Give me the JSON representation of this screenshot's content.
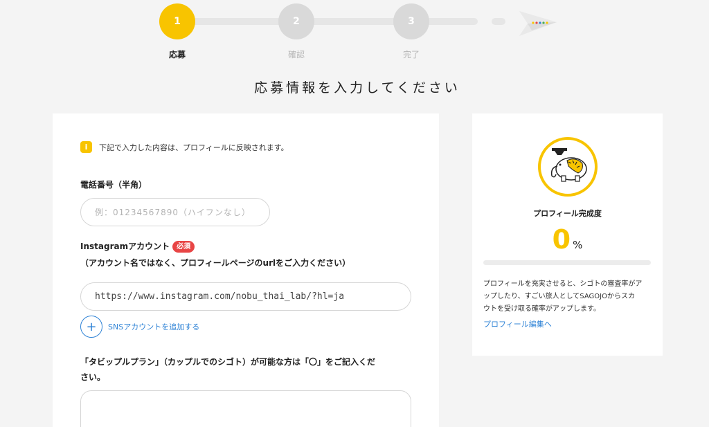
{
  "stepper": {
    "steps": [
      {
        "number": "1",
        "label": "応募",
        "state": "active"
      },
      {
        "number": "2",
        "label": "確認",
        "state": "inactive"
      },
      {
        "number": "3",
        "label": "完了",
        "state": "inactive"
      }
    ],
    "finish_icon": "paper-plane-icon"
  },
  "page_title": "応募情報を入力してください",
  "notice": {
    "icon": "info-icon",
    "text": "下記で入力した内容は、プロフィールに反映されます。"
  },
  "phone": {
    "label": "電話番号（半角）",
    "placeholder": "例：01234567890（ハイフンなし）",
    "value": ""
  },
  "instagram": {
    "label": "Instagramアカウント",
    "required_badge": "必須",
    "sub_label": "（アカウント名ではなく、プロフィールページのurlをご入力ください）",
    "value": "https://www.instagram.com/nobu_thai_lab/?hl=ja"
  },
  "add_sns": {
    "icon": "plus-icon",
    "label": "SNSアカウントを追加する"
  },
  "couple_plan": {
    "label_line1": "「タビップルプラン」（カップルでのシゴト）が可能な方は「〇」をご記入くだ",
    "label_line2": "さい。",
    "value": ""
  },
  "profile_panel": {
    "avatar_icon": "elephant-mascot-icon",
    "title": "プロフィール完成度",
    "percent": "0",
    "percent_sign": "%",
    "progress": 0,
    "desc_line1": "プロフィールを充実させると、シゴトの審査率がア",
    "desc_line2": "ップしたり、すごい旅人としてSAGOJOからスカ",
    "desc_line3": "ウトを受け取る確率がアップします。",
    "link": "プロフィール編集へ"
  },
  "colors": {
    "accent": "#f8c400",
    "link": "#2f83d6",
    "required": "#e84545",
    "inactive_step": "#d9d9d9",
    "background": "#f4f4f4"
  }
}
